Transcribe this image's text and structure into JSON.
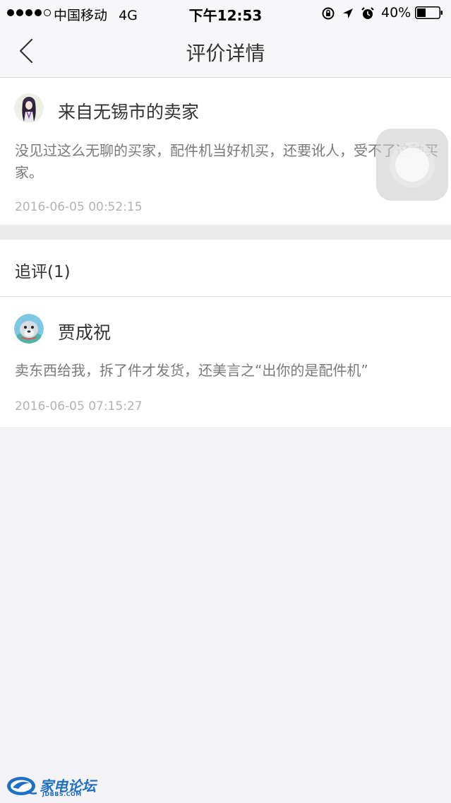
{
  "status_bar": {
    "carrier": "中国移动",
    "network": "4G",
    "time": "下午12:53",
    "battery_percent": "40%",
    "battery_level": 0.4,
    "signal_bars": 4
  },
  "nav": {
    "title": "评价详情",
    "back_icon": "chevron-left-icon"
  },
  "review": {
    "author": "来自无锡市的卖家",
    "text": "没见过这么无聊的买家，配件机当好机买，还要讹人，受不了这种买家。",
    "date": "2016-06-05 00:52:15"
  },
  "followup": {
    "header": "追评(1)",
    "author": "贾成祝",
    "text": "卖东西给我，拆了件才发货，还美言之“出你的是配件机”",
    "date": "2016-06-05 07:15:27"
  },
  "watermark": {
    "title": "家电论坛",
    "subtitle": "JDBBS.COM"
  },
  "colors": {
    "background": "#f3f3f6",
    "card": "#ffffff",
    "divider": "#ebebeb",
    "watermark": "#1f6fc4"
  }
}
